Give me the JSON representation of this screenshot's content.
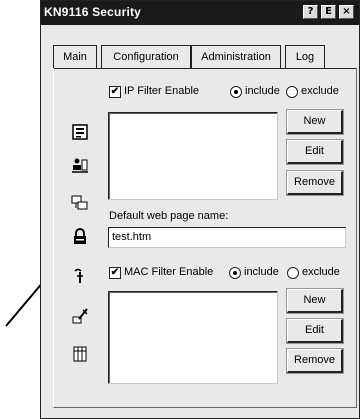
{
  "window": {
    "title": "KN9116 Security",
    "controls": [
      "?",
      "E",
      "×"
    ]
  },
  "tabs": [
    {
      "label": "Main",
      "active": false
    },
    {
      "label": "Configuration",
      "active": false
    },
    {
      "label": "Administration",
      "active": false
    },
    {
      "label": "Log",
      "active": false
    }
  ],
  "sidebar": {
    "icons": [
      "main-icon",
      "user-icon",
      "network-icon",
      "security-lock-icon",
      "firmware-icon",
      "tools-icon",
      "date-time-icon"
    ],
    "selected": "security-lock-icon"
  },
  "ip_filter": {
    "enable_label": "IP Filter Enable",
    "enabled": true,
    "include_label": "include",
    "exclude_label": "exclude",
    "mode": "include",
    "new_label": "New",
    "edit_label": "Edit",
    "remove_label": "Remove"
  },
  "default_page": {
    "label": "Default web page name:",
    "value": "test.htm"
  },
  "mac_filter": {
    "enable_label": "MAC Filter Enable",
    "enabled": true,
    "include_label": "include",
    "exclude_label": "exclude",
    "mode": "include",
    "new_label": "New",
    "edit_label": "Edit",
    "remove_label": "Remove"
  },
  "colors": {
    "titlebar": "#1a1a1a",
    "window_bg": "#e9e9e9"
  }
}
